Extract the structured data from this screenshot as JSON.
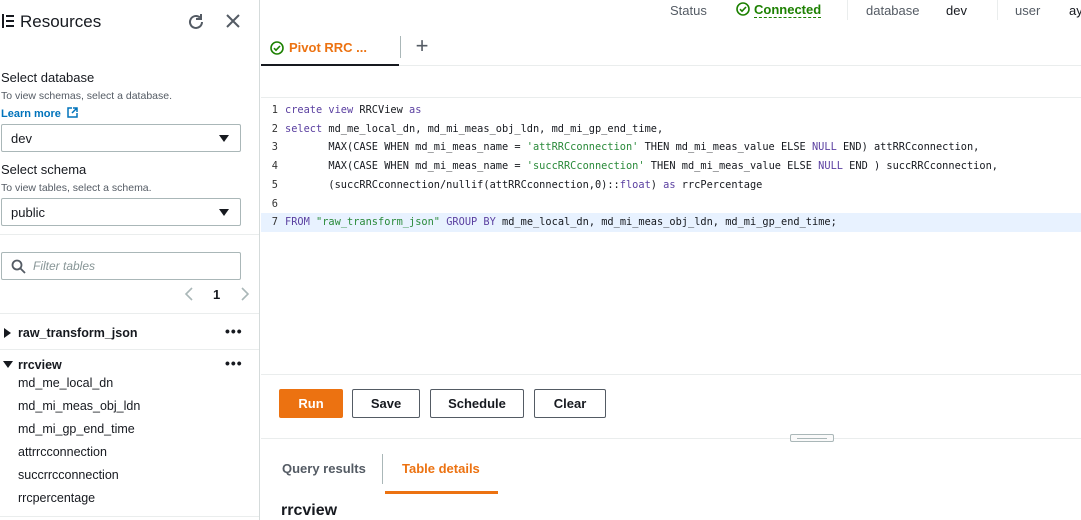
{
  "sidebar": {
    "title": "Resources",
    "database": {
      "label": "Select database",
      "description": "To view schemas, select a database.",
      "learn_more": "Learn more",
      "selected": "dev"
    },
    "schema": {
      "label": "Select schema",
      "description": "To view tables, select a schema.",
      "selected": "public"
    },
    "filter": {
      "placeholder": "Filter tables",
      "value": ""
    },
    "pagination": {
      "current_page": "1"
    },
    "tables": [
      {
        "name": "raw_transform_json",
        "expanded": false,
        "columns": []
      },
      {
        "name": "rrcview",
        "expanded": true,
        "columns": [
          "md_me_local_dn",
          "md_mi_meas_obj_ldn",
          "md_mi_gp_end_time",
          "attrrcconnection",
          "succrrcconnection",
          "rrcpercentage"
        ]
      }
    ],
    "more_actions": "•••"
  },
  "status_bar": {
    "status_label": "Status",
    "status_value": "Connected",
    "database_label": "database",
    "database_value": "dev",
    "user_label": "user",
    "user_value": "ay"
  },
  "tabs": [
    {
      "label": "Pivot RRC ...",
      "active": true
    }
  ],
  "add_tab_label": "+",
  "editor": {
    "lines": [
      {
        "number": "1",
        "html": "<span class=\"kw\">create view</span> RRCView <span class=\"kw\">as</span>"
      },
      {
        "number": "2",
        "html": "<span class=\"kw\">select</span> md_me_local_dn, md_mi_meas_obj_ldn, md_mi_gp_end_time,"
      },
      {
        "number": "3",
        "html": "       MAX(CASE WHEN md_mi_meas_name = <span class=\"str\">'attRRCconnection'</span> THEN md_mi_meas_value ELSE <span class=\"kw\">NULL</span> END) attRRCconnection,"
      },
      {
        "number": "4",
        "html": "       MAX(CASE WHEN md_mi_meas_name = <span class=\"str\">'succRRCconnection'</span> THEN md_mi_meas_value ELSE <span class=\"kw\">NULL</span> END ) succRRCconnection,"
      },
      {
        "number": "5",
        "html": "       (succRRCconnection/nullif(attRRCconnection,0)::<span class=\"kw\">float</span>) <span class=\"kw\">as</span> rrcPercentage"
      },
      {
        "number": "6",
        "html": ""
      },
      {
        "number": "7",
        "html": "<span class=\"kw\">FROM</span> <span class=\"str\">\"raw_transform_json\"</span> <span class=\"kw\">GROUP BY</span> md_me_local_dn, md_mi_meas_obj_ldn, md_mi_gp_end_time;"
      }
    ],
    "active_line": 7
  },
  "actions": {
    "run": "Run",
    "save": "Save",
    "schedule": "Schedule",
    "clear": "Clear"
  },
  "results_tabs": [
    {
      "label": "Query results",
      "active": false
    },
    {
      "label": "Table details",
      "active": true
    }
  ],
  "table_details": {
    "title": "rrcview"
  },
  "colors": {
    "accent": "#ec7211",
    "connected": "#1d8102",
    "link": "#0073bb",
    "active_line": "#e8f2ff"
  }
}
